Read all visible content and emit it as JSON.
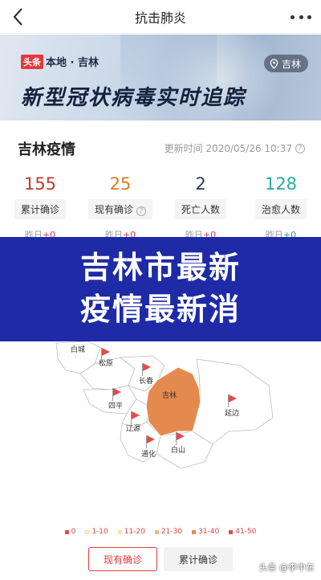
{
  "navbar": {
    "title": "抗击肺炎",
    "back_icon": "back-arrow-icon",
    "more_icon": "more-dots-icon"
  },
  "banner": {
    "brand_tag": "头条",
    "brand_local": "本地 · 吉林",
    "location_pill": "吉林",
    "title": "新型冠状病毒实时追踪"
  },
  "stats": {
    "heading": "吉林疫情",
    "update_time": "更新时间 2020/05/26 10:37",
    "columns": [
      {
        "value": "155",
        "label": "累计确诊",
        "yesterday_label": "昨日",
        "yesterday_value": "+0",
        "color": "#c0392b"
      },
      {
        "value": "25",
        "label": "现有确诊",
        "yesterday_label": "昨日",
        "yesterday_value": "+0",
        "color": "#e07a1f"
      },
      {
        "value": "2",
        "label": "死亡人数",
        "yesterday_label": "昨日",
        "yesterday_value": "+0",
        "color": "#2c3e50"
      },
      {
        "value": "128",
        "label": "治愈人数",
        "yesterday_label": "昨日",
        "yesterday_value": "+0",
        "color": "#29a9a0"
      }
    ]
  },
  "overlay": {
    "line1": "吉林市最新",
    "line2": "疫情最新消"
  },
  "map": {
    "regions": [
      "白城",
      "松原",
      "长春",
      "吉林",
      "四平",
      "辽源",
      "通化",
      "白山",
      "延边"
    ],
    "highlight_color": "#e58a4e"
  },
  "legend": [
    {
      "label": "0",
      "color": "#e54b4b"
    },
    {
      "label": "1-10",
      "color": "#fff6c4"
    },
    {
      "label": "11-20",
      "color": "#fde3a0"
    },
    {
      "label": "21-30",
      "color": "#f8b97a"
    },
    {
      "label": "31-40",
      "color": "#e58a4e"
    },
    {
      "label": "41-50",
      "color": "#d6553a"
    }
  ],
  "buttons": {
    "current": "现有确诊",
    "cumulative": "累计确诊"
  },
  "watermark": "头条 @李中东"
}
